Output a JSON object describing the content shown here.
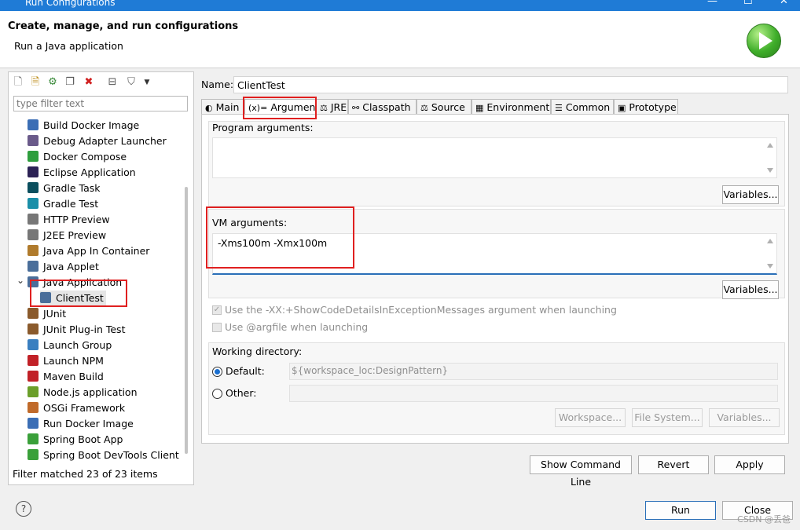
{
  "window": {
    "title": "Run Configurations"
  },
  "header": {
    "title": "Create, manage, and run configurations",
    "subtitle": "Run a Java application"
  },
  "sidebar": {
    "filter_placeholder": "type filter text",
    "items": [
      {
        "label": "Build Docker Image",
        "icon": "docker-icon",
        "color": "#3b6eb5"
      },
      {
        "label": "Debug Adapter Launcher",
        "icon": "debug-adapter-icon",
        "color": "#6a5a8a"
      },
      {
        "label": "Docker Compose",
        "icon": "docker-compose-icon",
        "color": "#2e9e3e"
      },
      {
        "label": "Eclipse Application",
        "icon": "eclipse-icon",
        "color": "#2c2255"
      },
      {
        "label": "Gradle Task",
        "icon": "gradle-icon",
        "color": "#0b4f5e"
      },
      {
        "label": "Gradle Test",
        "icon": "gradle-test-icon",
        "color": "#1b8fa8"
      },
      {
        "label": "HTTP Preview",
        "icon": "http-preview-icon",
        "color": "#777777"
      },
      {
        "label": "J2EE Preview",
        "icon": "j2ee-preview-icon",
        "color": "#777777"
      },
      {
        "label": "Java App In Container",
        "icon": "java-container-icon",
        "color": "#b07b2c"
      },
      {
        "label": "Java Applet",
        "icon": "java-applet-icon",
        "color": "#4a6e9a"
      },
      {
        "label": "Java Application",
        "icon": "java-application-icon",
        "color": "#4a6e9a",
        "expanded": true
      },
      {
        "label": "ClientTest",
        "icon": "java-class-icon",
        "color": "#4a6e9a",
        "child": true,
        "selected": true
      },
      {
        "label": "JUnit",
        "icon": "junit-icon",
        "color": "#8a5a2c"
      },
      {
        "label": "JUnit Plug-in Test",
        "icon": "junit-plugin-icon",
        "color": "#8a5a2c"
      },
      {
        "label": "Launch Group",
        "icon": "launch-group-icon",
        "color": "#3a7fc0"
      },
      {
        "label": "Launch NPM",
        "icon": "npm-icon",
        "color": "#c12127"
      },
      {
        "label": "Maven Build",
        "icon": "maven-icon",
        "color": "#c12127"
      },
      {
        "label": "Node.js application",
        "icon": "nodejs-icon",
        "color": "#6b9f2a"
      },
      {
        "label": "OSGi Framework",
        "icon": "osgi-icon",
        "color": "#c06a2a"
      },
      {
        "label": "Run Docker Image",
        "icon": "run-docker-icon",
        "color": "#3b6eb5"
      },
      {
        "label": "Spring Boot App",
        "icon": "spring-boot-icon",
        "color": "#3aa03a"
      },
      {
        "label": "Spring Boot DevTools Client",
        "icon": "spring-devtools-icon",
        "color": "#3aa03a"
      }
    ],
    "status": "Filter matched 23 of 23 items"
  },
  "config": {
    "name_label": "Name:",
    "name_value": "ClientTest",
    "tabs": [
      {
        "label": "Main",
        "icon": "main-tab-icon"
      },
      {
        "label": "Arguments",
        "icon": "arguments-tab-icon",
        "active": true
      },
      {
        "label": "JRE",
        "icon": "jre-tab-icon"
      },
      {
        "label": "Classpath",
        "icon": "classpath-tab-icon"
      },
      {
        "label": "Source",
        "icon": "source-tab-icon"
      },
      {
        "label": "Environment",
        "icon": "environment-tab-icon"
      },
      {
        "label": "Common",
        "icon": "common-tab-icon"
      },
      {
        "label": "Prototype",
        "icon": "prototype-tab-icon"
      }
    ],
    "program_args": {
      "label": "Program arguments:",
      "value": "",
      "variables_label": "Variables..."
    },
    "vm_args": {
      "label": "VM arguments:",
      "value": "-Xms100m -Xmx100m",
      "variables_label": "Variables..."
    },
    "option_show_code_details": {
      "label": "Use the -XX:+ShowCodeDetailsInExceptionMessages argument when launching",
      "checked": true,
      "enabled": false
    },
    "option_argfile": {
      "label": "Use @argfile when launching",
      "checked": false,
      "enabled": false
    },
    "working_dir": {
      "label": "Working directory:",
      "default_label": "Default:",
      "default_value": "${workspace_loc:DesignPattern}",
      "other_label": "Other:",
      "other_value": "",
      "selected": "default",
      "workspace_btn": "Workspace...",
      "filesystem_btn": "File System...",
      "variables_btn": "Variables..."
    },
    "show_command_line": "Show Command Line",
    "revert": "Revert",
    "apply": "Apply"
  },
  "footer": {
    "run": "Run",
    "close": "Close",
    "help_icon": "help-icon"
  },
  "watermark": "CSDN @丢爸",
  "colors": {
    "titlebar": "#1f7bd6",
    "highlight": "#e02020",
    "focus_underline": "#2a6fb8",
    "radio_selected": "#1a6fd0"
  }
}
